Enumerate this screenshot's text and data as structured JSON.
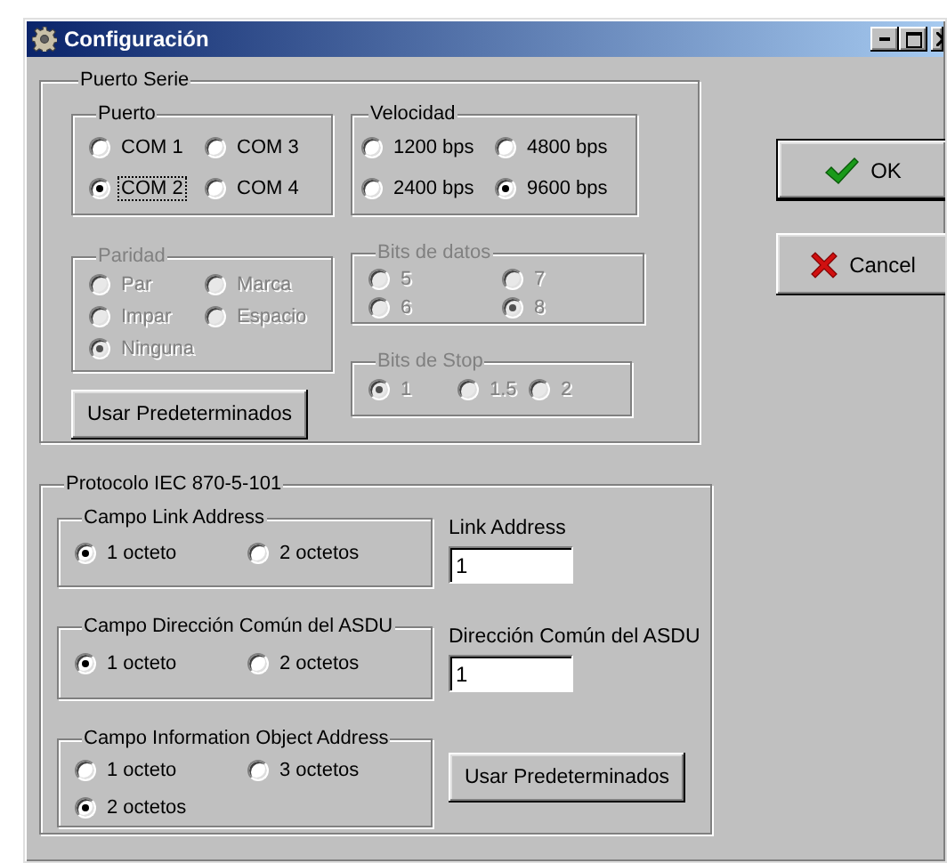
{
  "window": {
    "title": "Configuración"
  },
  "serial": {
    "title": "Puerto Serie",
    "left_groups": [
      {
        "title": "Puerto",
        "disabled": false,
        "options": [
          {
            "label": "COM 1",
            "selected": false,
            "focused": false
          },
          {
            "label": "COM 3",
            "selected": false,
            "focused": false
          },
          {
            "label": "COM 2",
            "selected": true,
            "focused": true
          },
          {
            "label": "COM 4",
            "selected": false,
            "focused": false
          }
        ]
      },
      {
        "title": "Paridad",
        "disabled": true,
        "options": [
          {
            "label": "Par",
            "selected": false
          },
          {
            "label": "Marca",
            "selected": false
          },
          {
            "label": "Impar",
            "selected": false
          },
          {
            "label": "Espacio",
            "selected": false
          },
          {
            "label": "Ninguna",
            "selected": true
          }
        ]
      }
    ],
    "right_groups": [
      {
        "title": "Velocidad",
        "disabled": false,
        "options": [
          {
            "label": "1200 bps",
            "selected": false
          },
          {
            "label": "4800 bps",
            "selected": false
          },
          {
            "label": "2400 bps",
            "selected": false
          },
          {
            "label": "9600 bps",
            "selected": true
          }
        ]
      },
      {
        "title": "Bits de datos",
        "disabled": true,
        "options": [
          {
            "label": "5",
            "selected": false
          },
          {
            "label": "7",
            "selected": false
          },
          {
            "label": "6",
            "selected": false
          },
          {
            "label": "8",
            "selected": true
          }
        ]
      },
      {
        "title": "Bits de Stop",
        "disabled": true,
        "options": [
          {
            "label": "1",
            "selected": true
          },
          {
            "label": "1.5",
            "selected": false
          },
          {
            "label": "2",
            "selected": false
          }
        ]
      }
    ],
    "defaults_button": "Usar Predeterminados"
  },
  "protocol": {
    "title": "Protocolo IEC 870-5-101",
    "groups": [
      {
        "title": "Campo Link Address",
        "disabled": false,
        "options": [
          {
            "label": "1 octeto",
            "selected": true
          },
          {
            "label": "2 octetos",
            "selected": false
          }
        ]
      },
      {
        "title": "Campo Dirección Común del ASDU",
        "disabled": false,
        "options": [
          {
            "label": "1 octeto",
            "selected": true
          },
          {
            "label": "2 octetos",
            "selected": false
          }
        ]
      },
      {
        "title": "Campo Information Object Address",
        "disabled": false,
        "options": [
          {
            "label": "1 octeto",
            "selected": false
          },
          {
            "label": "3 octetos",
            "selected": false
          },
          {
            "label": "2 octetos",
            "selected": true
          }
        ]
      }
    ],
    "fields": [
      {
        "label": "Link Address",
        "value": "1"
      },
      {
        "label": "Dirección Común del ASDU",
        "value": "1"
      }
    ],
    "defaults_button": "Usar Predeterminados"
  },
  "buttons": [
    {
      "kind": "ok",
      "label": "OK",
      "default": true
    },
    {
      "kind": "cancel",
      "label": "Cancel",
      "default": false
    }
  ]
}
